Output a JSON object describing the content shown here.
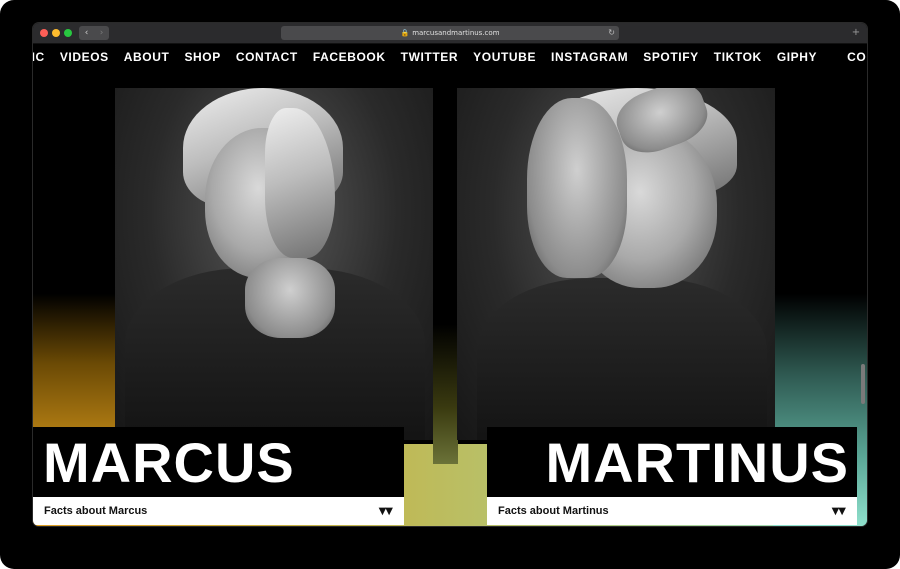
{
  "browser": {
    "url": "marcusandmartinus.com",
    "back_icon": "chevron-left-icon",
    "forward_icon": "chevron-right-icon",
    "back_glyph": "‹",
    "forward_glyph": "›",
    "new_tab_glyph": "+"
  },
  "nav": {
    "items": [
      "SIC",
      "VIDEOS",
      "ABOUT",
      "SHOP",
      "CONTACT",
      "FACEBOOK",
      "TWITTER",
      "YOUTUBE",
      "INSTAGRAM",
      "SPOTIFY",
      "TIKTOK",
      "GIPHY"
    ],
    "logo_icon": "mm-logo-icon",
    "trailing_item": "CO"
  },
  "profiles": {
    "marcus": {
      "name": "MARCUS",
      "facts_label": "Facts about Marcus",
      "arrows": "▼▼"
    },
    "martinus": {
      "name": "MARTINUS",
      "facts_label": "Facts about Martinus",
      "arrows": "▼▼"
    }
  },
  "colors": {
    "accent_left": "#e7a42a",
    "accent_right": "#9be2cd"
  }
}
